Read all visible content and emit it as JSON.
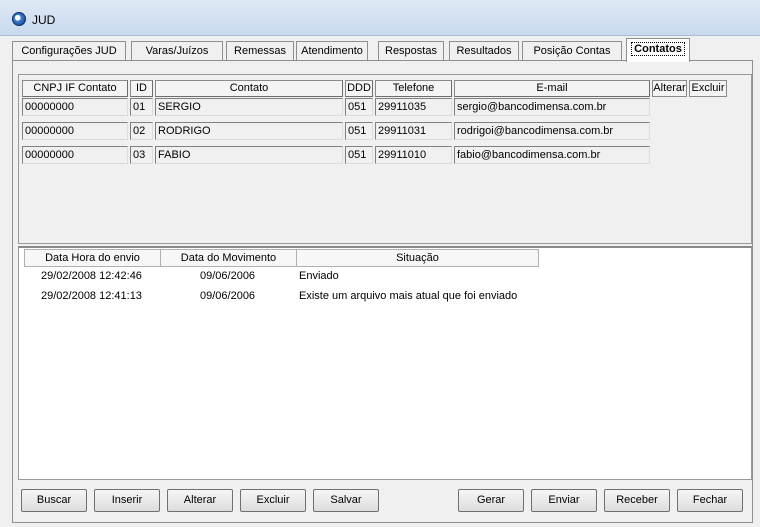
{
  "window": {
    "title": "JUD"
  },
  "tabs": [
    {
      "label": "Configurações JUD"
    },
    {
      "label": "Varas/Juízos"
    },
    {
      "label": "Remessas"
    },
    {
      "label": "Atendimento"
    },
    {
      "label": "Respostas"
    },
    {
      "label": "Resultados"
    },
    {
      "label": "Posição Contas"
    },
    {
      "label": "Contatos"
    }
  ],
  "active_tab": "Contatos",
  "contacts": {
    "columns": [
      "CNPJ IF Contato",
      "ID",
      "Contato",
      "DDD",
      "Telefone",
      "E-mail"
    ],
    "actions": {
      "edit": "Alterar",
      "delete": "Excluir"
    },
    "rows": [
      [
        "00000000",
        "01",
        "SERGIO",
        "051",
        "29911035",
        "sergio@bancodimensa.com.br"
      ],
      [
        "00000000",
        "02",
        "RODRIGO",
        "051",
        "29911031",
        "rodrigoi@bancodimensa.com.br"
      ],
      [
        "00000000",
        "03",
        "FABIO",
        "051",
        "29911010",
        "fabio@bancodimensa.com.br"
      ]
    ]
  },
  "log": {
    "columns": [
      "Data Hora do envio",
      "Data do Movimento",
      "Situação"
    ],
    "rows": [
      [
        "29/02/2008 12:42:46",
        "09/06/2006",
        "Enviado"
      ],
      [
        "29/02/2008 12:41:13",
        "09/06/2006",
        "Existe um arquivo mais atual que foi enviado"
      ]
    ]
  },
  "buttons": {
    "search": "Buscar",
    "insert": "Inserir",
    "edit": "Alterar",
    "delete": "Excluir",
    "save": "Salvar",
    "generate": "Gerar",
    "send": "Enviar",
    "receive": "Receber",
    "close": "Fechar"
  }
}
